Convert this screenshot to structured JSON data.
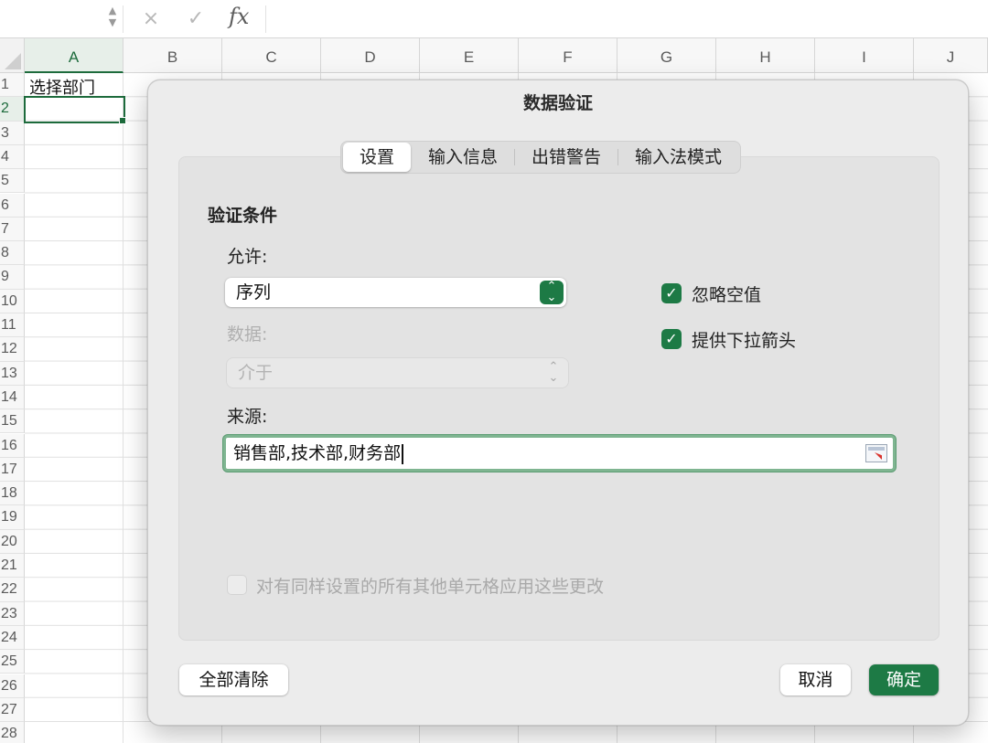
{
  "formula_bar": {
    "cancel_icon": "×",
    "confirm_icon": "✓",
    "fx_label": "fx"
  },
  "columns": [
    "A",
    "B",
    "C",
    "D",
    "E",
    "F",
    "G",
    "H",
    "I",
    "J"
  ],
  "rows": [
    "1",
    "2",
    "3",
    "4",
    "5",
    "6",
    "7",
    "8",
    "9",
    "10",
    "11",
    "12",
    "13",
    "14",
    "15",
    "16",
    "17",
    "18",
    "19",
    "20",
    "21",
    "22",
    "23",
    "24",
    "25",
    "26",
    "27",
    "28"
  ],
  "sheet": {
    "cell_A1": "选择部门",
    "active_column": "A",
    "active_row": "2"
  },
  "dialog": {
    "title": "数据验证",
    "tabs": [
      {
        "label": "设置",
        "selected": true
      },
      {
        "label": "输入信息",
        "selected": false
      },
      {
        "label": "出错警告",
        "selected": false
      },
      {
        "label": "输入法模式",
        "selected": false
      }
    ],
    "section_title": "验证条件",
    "allow_label": "允许:",
    "allow_value": "序列",
    "data_label": "数据:",
    "data_value": "介于",
    "ignore_blank_label": "忽略空值",
    "ignore_blank_checked": true,
    "dropdown_label": "提供下拉箭头",
    "dropdown_checked": true,
    "source_label": "来源:",
    "source_value": "销售部,技术部,财务部",
    "apply_all_label": "对有同样设置的所有其他单元格应用这些更改",
    "apply_all_checked": false,
    "clear_all_button": "全部清除",
    "cancel_button": "取消",
    "ok_button": "确定",
    "accent_color": "#1d7a45"
  }
}
